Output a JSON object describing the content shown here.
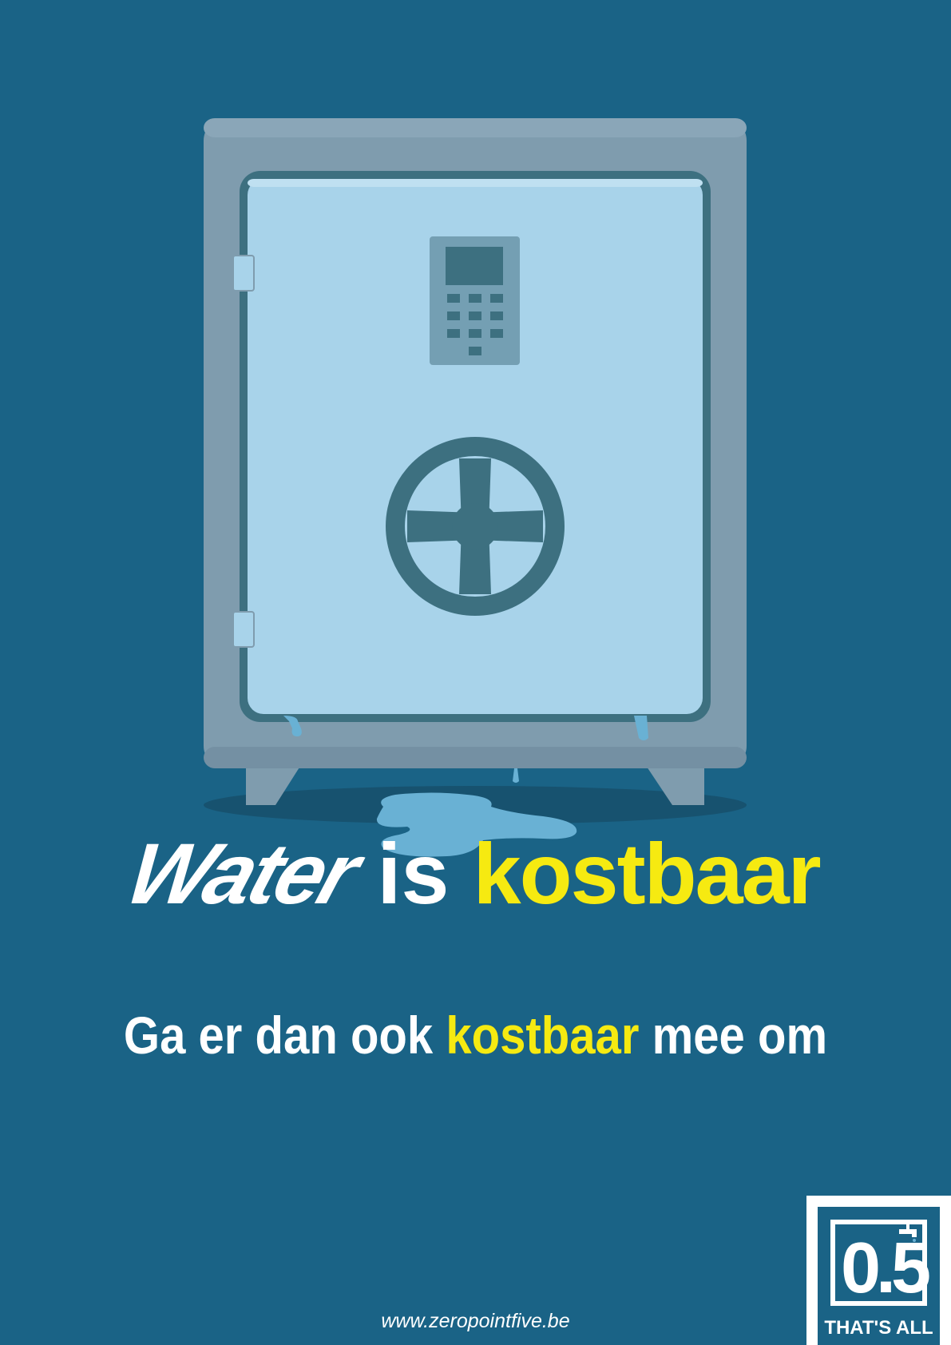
{
  "headline": {
    "word1": "Water",
    "word2": "is",
    "word3": "kostbaar"
  },
  "subline": {
    "part1": "Ga er dan ook ",
    "highlight": "kostbaar",
    "part2": " mee om"
  },
  "website": "www.zeropointfive.be",
  "logo": {
    "number": "0.5",
    "tagline": "THAT'S ALL"
  },
  "colors": {
    "background": "#1a6386",
    "accent_yellow": "#f6ea11",
    "safe_body": "#7f9cae",
    "safe_door": "#a8d3ea",
    "safe_dark": "#3d7080",
    "water": "#69b1d4"
  },
  "icons": [
    "safe-icon",
    "keypad-icon",
    "wheel-icon",
    "water-puddle-icon",
    "faucet-icon"
  ]
}
